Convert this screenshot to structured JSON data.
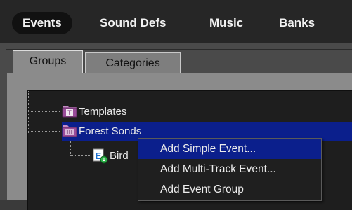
{
  "top_tabs": [
    {
      "label": "Events",
      "active": true
    },
    {
      "label": "Sound Defs",
      "active": false
    },
    {
      "label": "Music",
      "active": false
    },
    {
      "label": "Banks",
      "active": false
    }
  ],
  "sub_tabs": [
    {
      "label": "Groups",
      "active": true
    },
    {
      "label": "Categories",
      "active": false
    }
  ],
  "tree": {
    "items": [
      {
        "label": "Templates",
        "icon": "folder-template-icon",
        "badge": "T"
      },
      {
        "label": "Forest So",
        "suffix": "nds",
        "icon": "folder-group-icon",
        "selected": true
      },
      {
        "label": "Bird",
        "icon": "simple-event-icon",
        "badge": "E"
      }
    ]
  },
  "context_menu": {
    "items": [
      {
        "label": "Add Simple Event...",
        "highlighted": true
      },
      {
        "label": "Add Multi-Track Event...",
        "highlighted": false
      },
      {
        "label": "Add Event Group",
        "highlighted": false
      }
    ]
  },
  "colors": {
    "selection": "#0b1f8c",
    "tree_bg": "#1e1e1e",
    "topbar_bg": "#262626",
    "folder_purple": "#9a4c9a",
    "event_green": "#2fb24a"
  }
}
